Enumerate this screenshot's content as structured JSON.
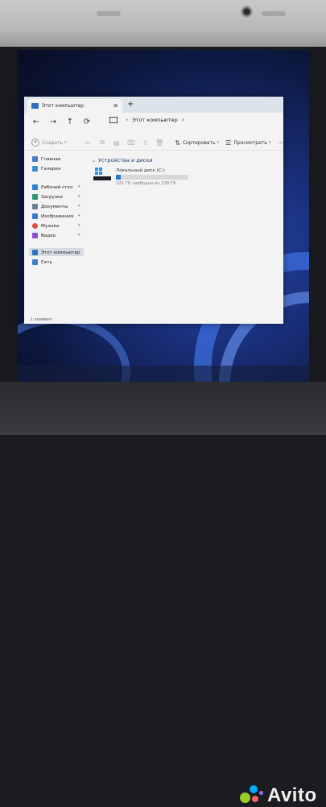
{
  "window": {
    "tab_title": "Этот компьютер",
    "new_tab": "+",
    "close_tab": "✕"
  },
  "nav": {
    "back": "←",
    "forward": "→",
    "up": "↑",
    "refresh": "⟳",
    "address": [
      "Этот компьютер"
    ]
  },
  "toolbar": {
    "create_label": "Создать",
    "sort_label": "Сортировать",
    "view_label": "Просмотреть",
    "more": "···"
  },
  "sidebar": {
    "items": [
      {
        "label": "Главная",
        "icon": "home-icon",
        "color": "#4a7ac8"
      },
      {
        "label": "Галерея",
        "icon": "gallery-icon",
        "color": "#3f8fd6"
      },
      {
        "label": "Рабочий стол",
        "icon": "desktop-icon",
        "color": "#2f7fd0",
        "pinned": true
      },
      {
        "label": "Загрузки",
        "icon": "downloads-icon",
        "color": "#2a9a6e",
        "pinned": true
      },
      {
        "label": "Документы",
        "icon": "documents-icon",
        "color": "#6f7f90",
        "pinned": true
      },
      {
        "label": "Изображения",
        "icon": "pictures-icon",
        "color": "#3a78d0",
        "pinned": true
      },
      {
        "label": "Музыка",
        "icon": "music-icon",
        "color": "#d8503a",
        "pinned": true
      },
      {
        "label": "Видео",
        "icon": "videos-icon",
        "color": "#8a4fd0",
        "pinned": true
      },
      {
        "label": "Этот компьютер",
        "icon": "this-pc-icon",
        "color": "#2f6fbf",
        "selected": true
      },
      {
        "label": "Сеть",
        "icon": "network-icon",
        "color": "#3a80c8"
      }
    ]
  },
  "content": {
    "section": "Устройства и диски",
    "drive_name": "Локальный диск (C:)",
    "drive_free": "221 ГБ свободно из 238 ГБ",
    "drive_used_fraction": 0.07
  },
  "status": {
    "count": "1 элемент"
  },
  "watermark": {
    "brand": "Avito"
  }
}
